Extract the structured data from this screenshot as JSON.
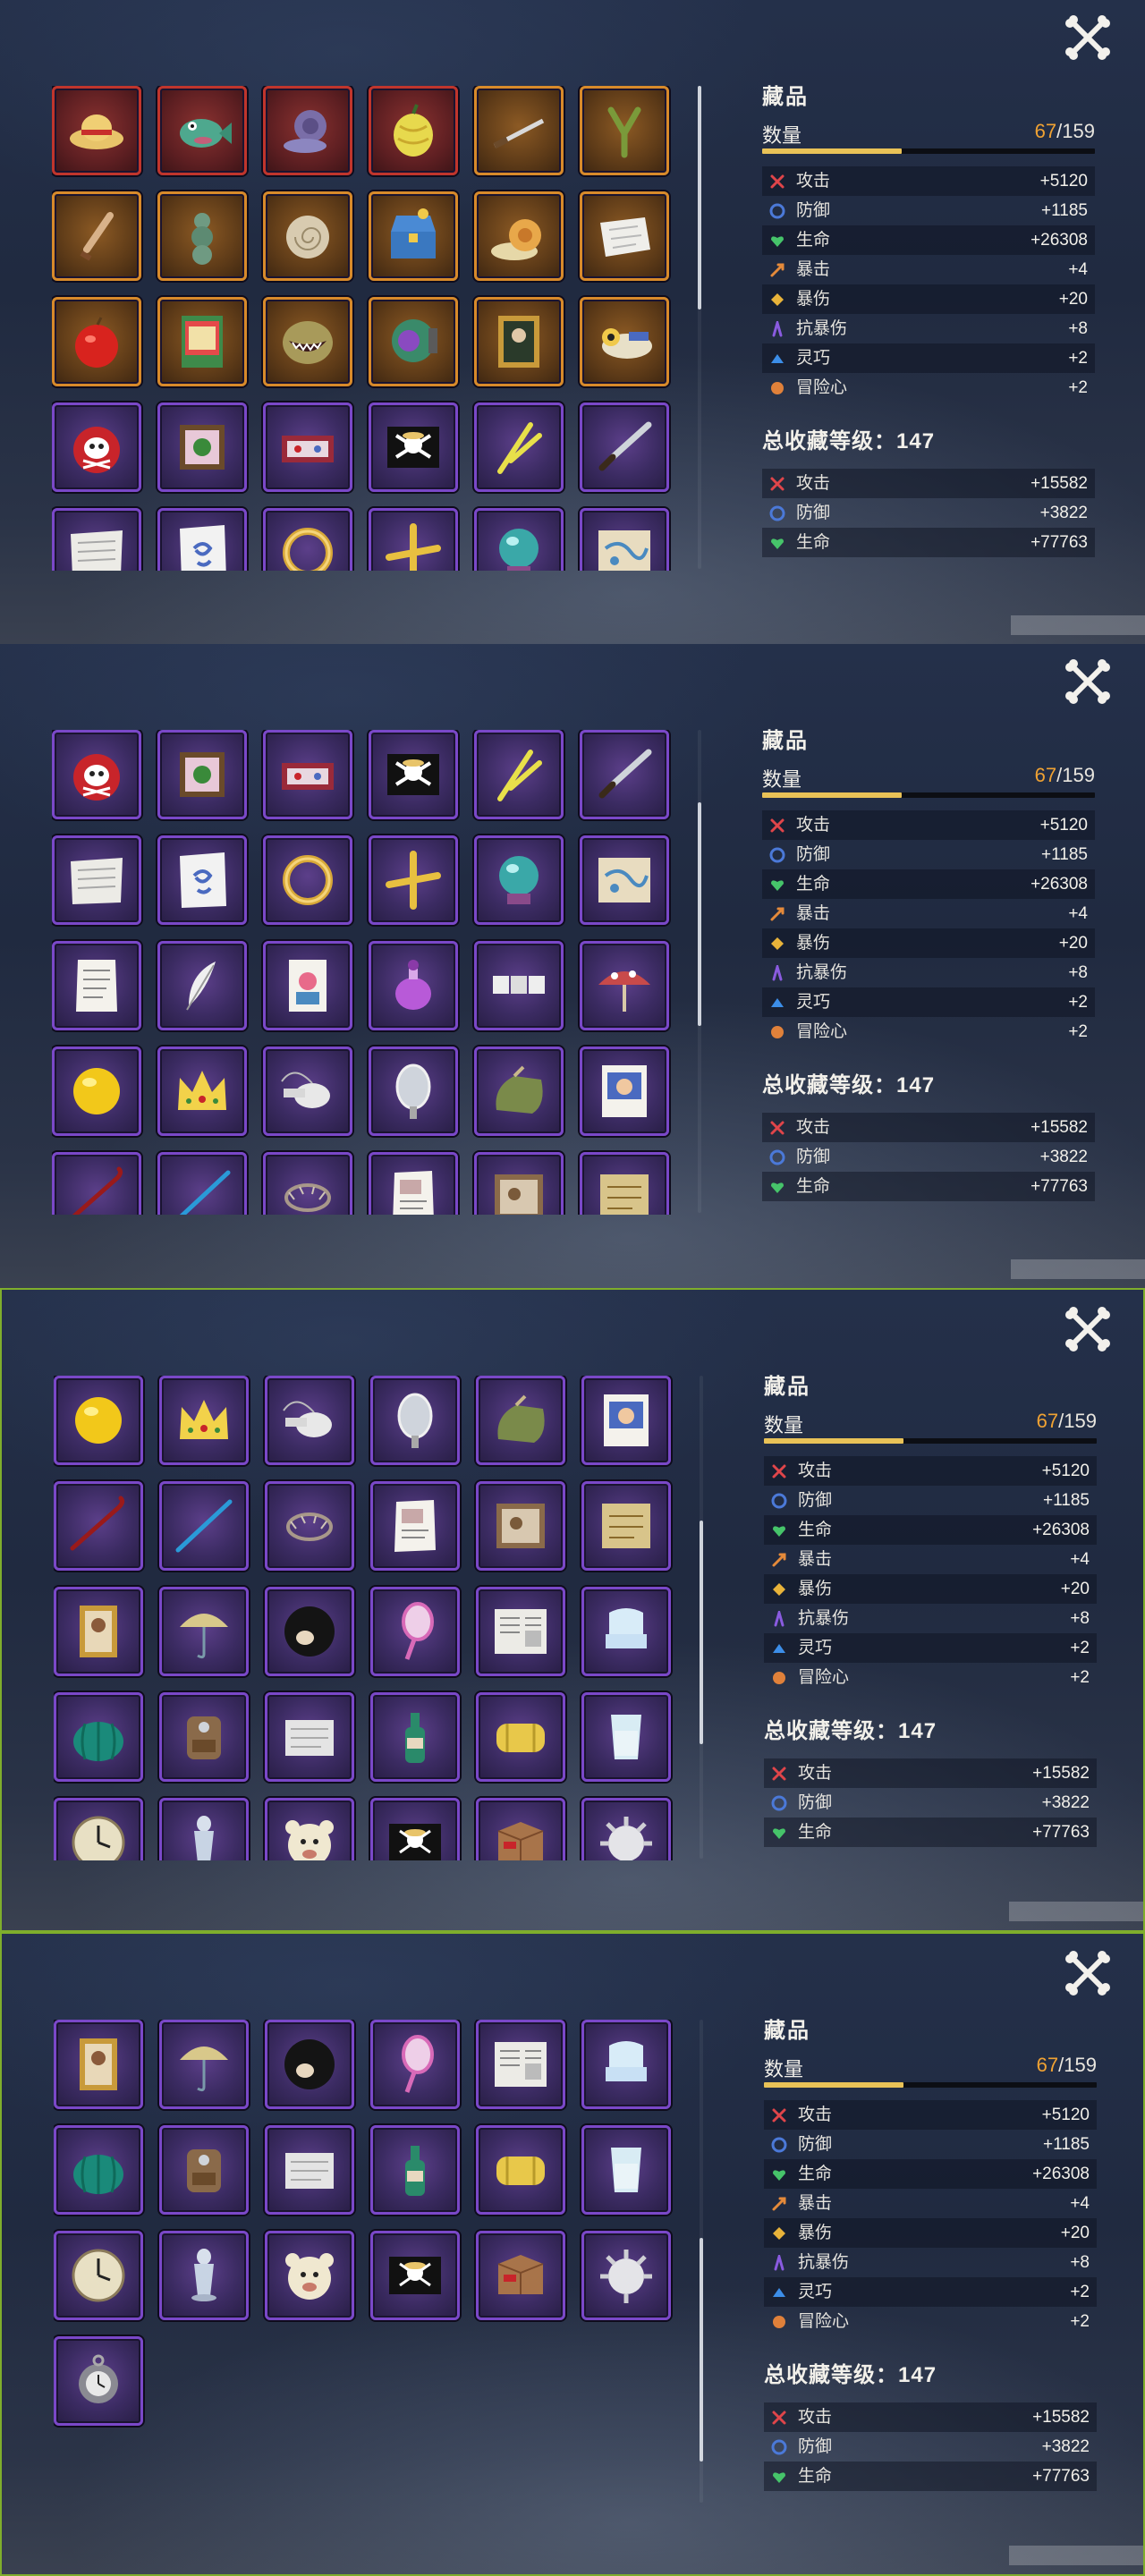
{
  "summary": {
    "title": "藏品",
    "count_label": "数量",
    "owned": "67",
    "separator": "/",
    "total": "159",
    "progress": 0.42,
    "total_level_label": "总收藏等级：147",
    "stats": [
      {
        "name": "攻击",
        "value": "+5120",
        "icon": "attack-icon",
        "color": "#e0454a"
      },
      {
        "name": "防御",
        "value": "+1185",
        "icon": "defense-icon",
        "color": "#4b79d8"
      },
      {
        "name": "生命",
        "value": "+26308",
        "icon": "life-icon",
        "color": "#46c46a"
      },
      {
        "name": "暴击",
        "value": "+4",
        "icon": "crit-icon",
        "color": "#e58a3a"
      },
      {
        "name": "暴伤",
        "value": "+20",
        "icon": "crit-damage-icon",
        "color": "#e8b33a"
      },
      {
        "name": "抗暴伤",
        "value": "+8",
        "icon": "crit-resist-icon",
        "color": "#8a5be0"
      },
      {
        "name": "灵巧",
        "value": "+2",
        "icon": "agility-icon",
        "color": "#3c8ee8"
      },
      {
        "name": "冒险心",
        "value": "+2",
        "icon": "adventure-icon",
        "color": "#e0813a"
      }
    ],
    "total_stats": [
      {
        "name": "攻击",
        "value": "+15582",
        "icon": "attack-icon",
        "color": "#e0454a"
      },
      {
        "name": "防御",
        "value": "+3822",
        "icon": "defense-icon",
        "color": "#4b79d8"
      },
      {
        "name": "生命",
        "value": "+77763",
        "icon": "life-icon",
        "color": "#46c46a"
      }
    ]
  },
  "items": [
    {
      "icon": "straw-hat-icon",
      "rarity": "red"
    },
    {
      "icon": "green-fish-icon",
      "rarity": "red"
    },
    {
      "icon": "purple-snail-icon",
      "rarity": "red"
    },
    {
      "icon": "devil-fruit-icon",
      "rarity": "red"
    },
    {
      "icon": "katana-icon",
      "rarity": "orange"
    },
    {
      "icon": "slingshot-icon",
      "rarity": "orange"
    },
    {
      "icon": "dagger-icon",
      "rarity": "orange"
    },
    {
      "icon": "stone-figure-icon",
      "rarity": "orange"
    },
    {
      "icon": "ammonite-shell-icon",
      "rarity": "orange"
    },
    {
      "icon": "treasure-chest-icon",
      "rarity": "orange"
    },
    {
      "icon": "snail-phone-icon",
      "rarity": "orange"
    },
    {
      "icon": "map-paper-icon",
      "rarity": "orange"
    },
    {
      "icon": "red-apple-icon",
      "rarity": "orange"
    },
    {
      "icon": "comic-book-icon",
      "rarity": "orange"
    },
    {
      "icon": "monster-mouth-icon",
      "rarity": "orange"
    },
    {
      "icon": "diving-helmet-icon",
      "rarity": "orange"
    },
    {
      "icon": "portrait-frame-icon",
      "rarity": "orange"
    },
    {
      "icon": "sea-train-icon",
      "rarity": "orange"
    },
    {
      "icon": "skull-fruit-icon",
      "rarity": "purple"
    },
    {
      "icon": "picture-book-icon",
      "rarity": "purple"
    },
    {
      "icon": "jewelry-case-icon",
      "rarity": "purple"
    },
    {
      "icon": "jolly-roger-icon",
      "rarity": "purple"
    },
    {
      "icon": "crossed-swords-icon",
      "rarity": "purple"
    },
    {
      "icon": "knife-icon",
      "rarity": "purple"
    },
    {
      "icon": "old-map-icon",
      "rarity": "purple"
    },
    {
      "icon": "spiral-note-icon",
      "rarity": "purple"
    },
    {
      "icon": "gold-ring-icon",
      "rarity": "purple"
    },
    {
      "icon": "golden-cross-icon",
      "rarity": "purple"
    },
    {
      "icon": "crystal-ball-icon",
      "rarity": "purple"
    },
    {
      "icon": "sea-chart-icon",
      "rarity": "purple"
    },
    {
      "icon": "letter-icon",
      "rarity": "purple"
    },
    {
      "icon": "feather-icon",
      "rarity": "purple"
    },
    {
      "icon": "playing-card-icon",
      "rarity": "purple"
    },
    {
      "icon": "perfume-bottle-icon",
      "rarity": "purple"
    },
    {
      "icon": "dice-icon",
      "rarity": "purple"
    },
    {
      "icon": "mushroom-umbrella-icon",
      "rarity": "purple"
    },
    {
      "icon": "yellow-ball-icon",
      "rarity": "purple"
    },
    {
      "icon": "crown-icon",
      "rarity": "purple"
    },
    {
      "icon": "whistle-icon",
      "rarity": "purple"
    },
    {
      "icon": "hand-mirror-icon",
      "rarity": "purple"
    },
    {
      "icon": "sack-icon",
      "rarity": "purple"
    },
    {
      "icon": "wanted-poster-icon",
      "rarity": "purple"
    },
    {
      "icon": "cane-icon",
      "rarity": "purple"
    },
    {
      "icon": "blue-staff-icon",
      "rarity": "purple"
    },
    {
      "icon": "thorn-wreath-icon",
      "rarity": "purple"
    },
    {
      "icon": "paper-note-icon",
      "rarity": "purple"
    },
    {
      "icon": "photo-frame-icon",
      "rarity": "purple"
    },
    {
      "icon": "parchment-map-icon",
      "rarity": "purple"
    },
    {
      "icon": "framed-photo-icon",
      "rarity": "purple"
    },
    {
      "icon": "parasol-icon",
      "rarity": "purple"
    },
    {
      "icon": "black-wig-icon",
      "rarity": "purple"
    },
    {
      "icon": "pink-mirror-icon",
      "rarity": "purple"
    },
    {
      "icon": "newspaper-icon",
      "rarity": "purple"
    },
    {
      "icon": "chair-icon",
      "rarity": "purple"
    },
    {
      "icon": "pumpkin-icon",
      "rarity": "purple"
    },
    {
      "icon": "backpack-icon",
      "rarity": "purple"
    },
    {
      "icon": "notebook-icon",
      "rarity": "purple"
    },
    {
      "icon": "bottle-icon",
      "rarity": "purple"
    },
    {
      "icon": "yellow-bag-icon",
      "rarity": "purple"
    },
    {
      "icon": "glass-cup-icon",
      "rarity": "purple"
    },
    {
      "icon": "clock-icon",
      "rarity": "purple"
    },
    {
      "icon": "statue-icon",
      "rarity": "purple"
    },
    {
      "icon": "bear-mask-icon",
      "rarity": "purple"
    },
    {
      "icon": "pirate-flag-icon",
      "rarity": "purple"
    },
    {
      "icon": "cardboard-box-icon",
      "rarity": "purple"
    },
    {
      "icon": "spiked-ball-icon",
      "rarity": "purple"
    },
    {
      "icon": "pocket-watch-icon",
      "rarity": "purple"
    }
  ],
  "panels": [
    {
      "first_row": 0,
      "scroll": 0.0,
      "selected": false
    },
    {
      "first_row": 3,
      "scroll": 0.28,
      "selected": false
    },
    {
      "first_row": 6,
      "scroll": 0.56,
      "selected": true
    },
    {
      "first_row": 8,
      "scroll": 0.84,
      "selected": true
    }
  ]
}
